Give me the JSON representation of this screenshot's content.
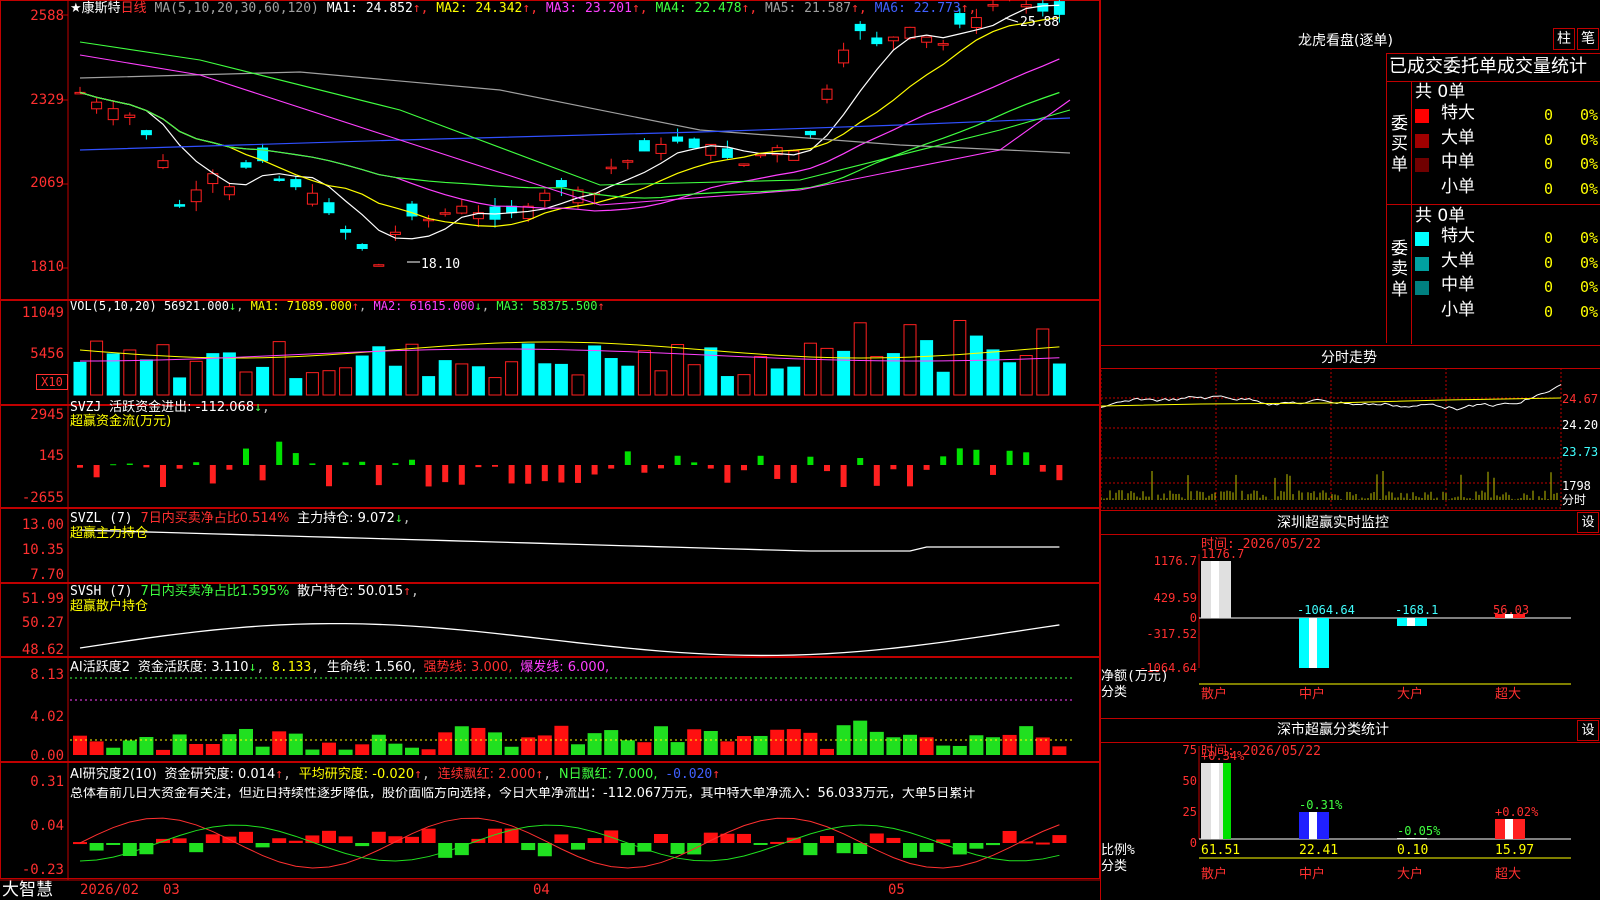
{
  "stock": {
    "name": "★康斯特",
    "period": "日线",
    "ma_label": "MA(5,10,20,30,60,120)",
    "ma": [
      {
        "name": "MA1",
        "value": "24.852",
        "arrow": "↑",
        "color": "#ffffff"
      },
      {
        "name": "MA2",
        "value": "24.342",
        "arrow": "↑",
        "color": "#ffff00"
      },
      {
        "name": "MA3",
        "value": "23.201",
        "arrow": "↑",
        "color": "#ff40ff"
      },
      {
        "name": "MA4",
        "value": "22.478",
        "arrow": "↑",
        "color": "#40ff40"
      },
      {
        "name": "MA5",
        "value": "21.587",
        "arrow": "↑",
        "color": "#a0a0a0"
      },
      {
        "name": "MA6",
        "value": "22.773",
        "arrow": "↑",
        "color": "#4060ff"
      }
    ],
    "price_axis": [
      "2588",
      "2329",
      "2069",
      "1810"
    ],
    "high_label": "25.88",
    "low_label": "18.10"
  },
  "vol": {
    "label": "VOL(5,10,20)",
    "value": "56921.000",
    "ma1": "MA1: 71089.000",
    "ma2": "MA2: 61615.000",
    "ma3": "MA3: 58375.500",
    "axis": [
      "11049",
      "5456"
    ],
    "unit": "X10"
  },
  "svzj": {
    "label": "SVZJ",
    "line1": "活跃资金进出: -112.068",
    "line2": "超赢资金流(万元)",
    "axis": [
      "2945",
      "145",
      "-2655"
    ]
  },
  "svzl": {
    "label": "SVZL (7)",
    "line1a": "7日内买卖净占比0.514%",
    "line1b": "主力持仓: 9.072",
    "line2": "超赢主力持仓",
    "axis": [
      "13.00",
      "10.35",
      "7.70"
    ]
  },
  "svsh": {
    "label": "SVSH (7)",
    "line1a": "7日内买卖净占比1.595%",
    "line1b": "散户持仓: 50.015",
    "line2": "超赢散户持仓",
    "axis": [
      "51.99",
      "50.27",
      "48.62"
    ]
  },
  "ai1": {
    "label": "AI活跃度2",
    "a": "资金活跃度: 3.110",
    "b": "8.133",
    "c": "生命线: 1.560,",
    "d": "强势线: 3.000,",
    "e": "爆发线: 6.000,",
    "axis": [
      "8.13",
      "4.02",
      "0.00"
    ]
  },
  "ai2": {
    "label": "AI研究度2(10)",
    "a": "资金研究度: 0.014",
    "b": "平均研究度: -0.020",
    "c": "连续飘红: 2.000",
    "d": "N日飘红: 7.000,",
    "e": "-0.020",
    "comment": "总体看前几日大资金有关注，但近日持续性逐步降低，股价面临方向选择，今日大单净流出：-112.067万元，其中特大单净流入：56.033万元，大单5日累计",
    "axis": [
      "0.31",
      "0.04",
      "-0.23"
    ]
  },
  "bottom": {
    "brand": "大智慧",
    "dates": [
      "2026/02",
      "03",
      "04",
      "05"
    ]
  },
  "right": {
    "lhb_title": "龙虎看盘(逐单)",
    "btn_zhu": "柱",
    "btn_bi": "笔",
    "section_title": "已成交委托单成交量统计",
    "buy_label": "委买单",
    "sell_label": "委卖单",
    "buy_total": "共 0单",
    "sell_total": "共 0单",
    "buy_rows": [
      {
        "name": "特大",
        "count": "0",
        "pct": "0%",
        "color": "#ff0000"
      },
      {
        "name": "大单",
        "count": "0",
        "pct": "0%",
        "color": "#a00000"
      },
      {
        "name": "中单",
        "count": "0",
        "pct": "0%",
        "color": "#700000"
      },
      {
        "name": "小单",
        "count": "0",
        "pct": "0%",
        "color": ""
      }
    ],
    "sell_rows": [
      {
        "name": "特大",
        "count": "0",
        "pct": "0%",
        "color": "#00ffff"
      },
      {
        "name": "大单",
        "count": "0",
        "pct": "0%",
        "color": "#00a0a0"
      },
      {
        "name": "中单",
        "count": "0",
        "pct": "0%",
        "color": "#008080"
      },
      {
        "name": "小单",
        "count": "0",
        "pct": "0%",
        "color": ""
      }
    ],
    "fenshi_title": "分时走势",
    "fenshi_axis": [
      "24.67",
      "24.20",
      "23.73"
    ],
    "fenshi_vol": "1798",
    "fenshi_unit": "分时",
    "monitor_title": "深圳超赢实时监控",
    "monitor_btn": "设",
    "monitor_time": "时间: 2026/05/22",
    "monitor_axis": [
      "1176.7",
      "429.59",
      "0",
      "-317.52",
      "-1064.64"
    ],
    "monitor_ylabel": "净额(万元)",
    "monitor_xlabel": "分类",
    "monitor_bars": [
      {
        "cat": "散户",
        "value": "1176.7"
      },
      {
        "cat": "中户",
        "value": "-1064.64"
      },
      {
        "cat": "大户",
        "value": "-168.1"
      },
      {
        "cat": "超大",
        "value": "56.03"
      }
    ],
    "stat_title": "深市超赢分类统计",
    "stat_btn": "设",
    "stat_time": "时间: 2026/05/22",
    "stat_axis": [
      "75",
      "50",
      "25",
      "0"
    ],
    "stat_ylabel": "比例%",
    "stat_xlabel": "分类",
    "stat_bars": [
      {
        "cat": "散户",
        "value": "61.51",
        "delta": "+0.34%"
      },
      {
        "cat": "中户",
        "value": "22.41",
        "delta": "-0.31%"
      },
      {
        "cat": "大户",
        "value": "0.10",
        "delta": "-0.05%"
      },
      {
        "cat": "超大",
        "value": "15.97",
        "delta": "+0.02%"
      }
    ]
  }
}
